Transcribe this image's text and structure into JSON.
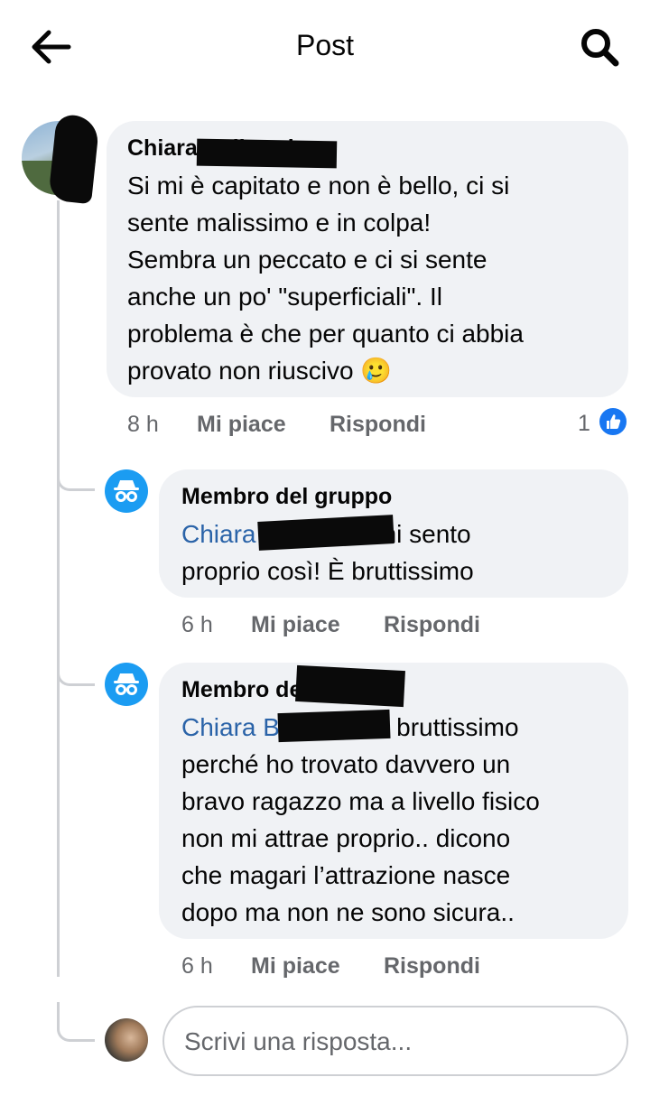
{
  "header": {
    "title": "Post",
    "back_icon": "arrow-left-icon",
    "search_icon": "search-icon"
  },
  "colors": {
    "bubble_bg": "#f0f2f5",
    "mention": "#2a63a8",
    "meta": "#65676b",
    "like_blue": "#1877f2",
    "anon_blue": "#1b9cf2"
  },
  "comments": [
    {
      "author": "Chiara Balbontin",
      "lines": [
        "Si mi è capitato e non è bello, ci si",
        "sente malissimo e in colpa!",
        "Sembra un peccato e ci si sente",
        "anche un po' \"superficiali\". Il",
        "problema è che per quanto ci abbia",
        "provato non riuscivo 🥲"
      ],
      "time": "8 h",
      "like_label": "Mi piace",
      "reply_label": "Rispondi",
      "like_count": "1"
    }
  ],
  "replies": [
    {
      "author": "Membro del gruppo",
      "mention": "Chiara Balbontin",
      "lines": [
        "mi sento",
        "proprio così! È bruttissimo"
      ],
      "time": "6 h",
      "like_label": "Mi piace",
      "reply_label": "Rispondi"
    },
    {
      "author": "Membro del gruppo",
      "mention": "Chiara Balbontin",
      "lines": [
        "è bruttissimo",
        "perché ho trovato davvero un",
        "bravo ragazzo ma a livello fisico",
        "non mi attrae proprio.. dicono",
        "che magari l’attrazione nasce",
        "dopo ma non ne sono sicura.."
      ],
      "time": "6 h",
      "like_label": "Mi piace",
      "reply_label": "Rispondi"
    }
  ],
  "composer": {
    "placeholder": "Scrivi una risposta...",
    "value": ""
  }
}
